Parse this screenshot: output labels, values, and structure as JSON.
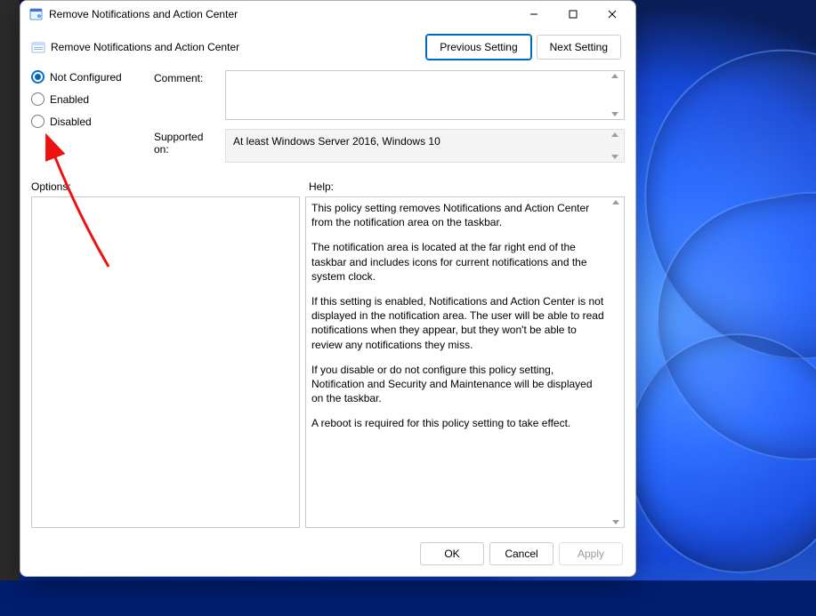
{
  "window": {
    "title": "Remove Notifications and Action Center"
  },
  "header": {
    "policy_name": "Remove Notifications and Action Center",
    "previous_setting": "Previous Setting",
    "next_setting": "Next Setting"
  },
  "radios": {
    "not_configured": "Not Configured",
    "enabled": "Enabled",
    "disabled": "Disabled",
    "selected": "not_configured"
  },
  "fields": {
    "comment_label": "Comment:",
    "comment_value": "",
    "supported_label": "Supported on:",
    "supported_value": "At least Windows Server 2016, Windows 10"
  },
  "panels": {
    "options_label": "Options:",
    "help_label": "Help:"
  },
  "help": {
    "p1": "This policy setting removes Notifications and Action Center from the notification area on the taskbar.",
    "p2": "The notification area is located at the far right end of the taskbar and includes icons for current notifications and the system clock.",
    "p3": "If this setting is enabled, Notifications and Action Center is not displayed in the notification area. The user will be able to read notifications when they appear, but they won't be able to review any notifications they miss.",
    "p4": "If you disable or do not configure this policy setting, Notification and Security and Maintenance will be displayed on the taskbar.",
    "p5": "A reboot is required for this policy setting to take effect."
  },
  "footer": {
    "ok": "OK",
    "cancel": "Cancel",
    "apply": "Apply"
  }
}
